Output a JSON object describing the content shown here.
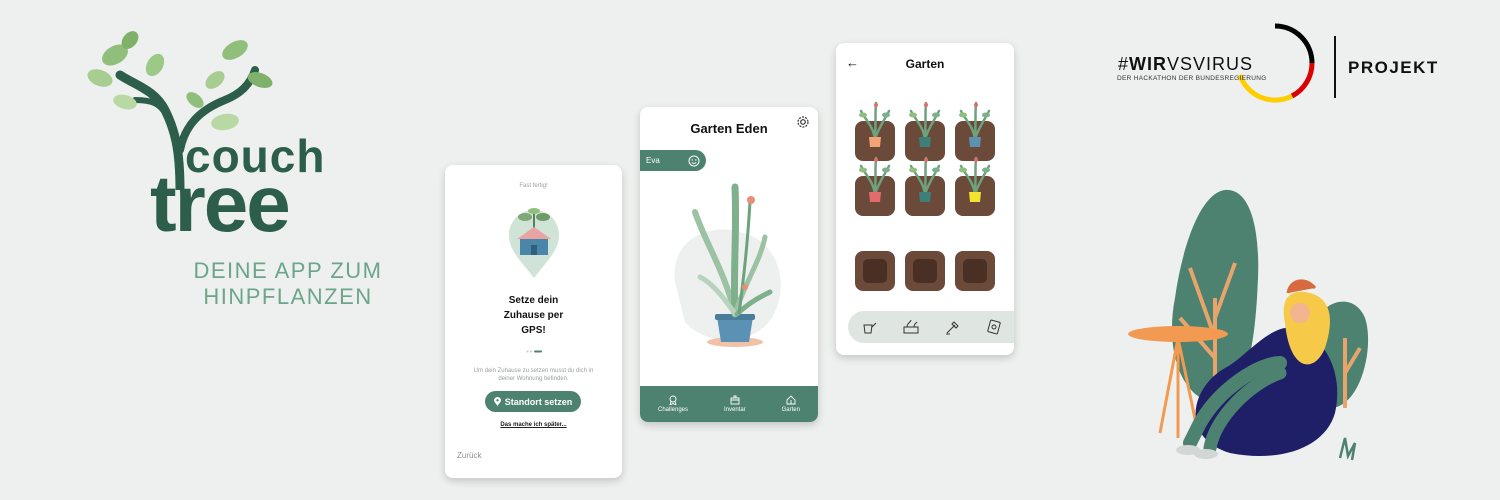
{
  "brand": {
    "word1": "couch",
    "word2": "tree",
    "tagline_line1": "DEINE APP ZUM",
    "tagline_line2": "HINPFLANZEN"
  },
  "screen_onboarding": {
    "header": "Fast fertig!",
    "title_line1": "Setze dein",
    "title_line2": "Zuhause per",
    "title_line3": "GPS!",
    "step": {
      "current": 2,
      "total": 3
    },
    "desc_line1": "Um dein Zuhause zu setzen musst du dich in",
    "desc_line2": "deiner Wohnung befinden.",
    "button": "Standort setzen",
    "later": "Das mache ich später...",
    "back": "Zurück"
  },
  "screen_garden_eden": {
    "title": "Garten Eden",
    "user": "Eva",
    "nav": [
      "Challenges",
      "Inventar",
      "Garten"
    ]
  },
  "screen_garden": {
    "title": "Garten",
    "pots": [
      "orange",
      "teal",
      "blue",
      "red",
      "teal",
      "yellow",
      "empty",
      "empty",
      "empty"
    ]
  },
  "hackathon": {
    "hashtag": "#",
    "name_a": "WIR",
    "name_b": "VS",
    "name_c": "VIRUS",
    "subline": "DER HACKATHON DER BUNDESREGIERUNG",
    "label": "PROJEKT"
  },
  "colors": {
    "brand_green": "#2d5e4c",
    "accent_green": "#4d8270",
    "soil": "#6b4a3a"
  }
}
